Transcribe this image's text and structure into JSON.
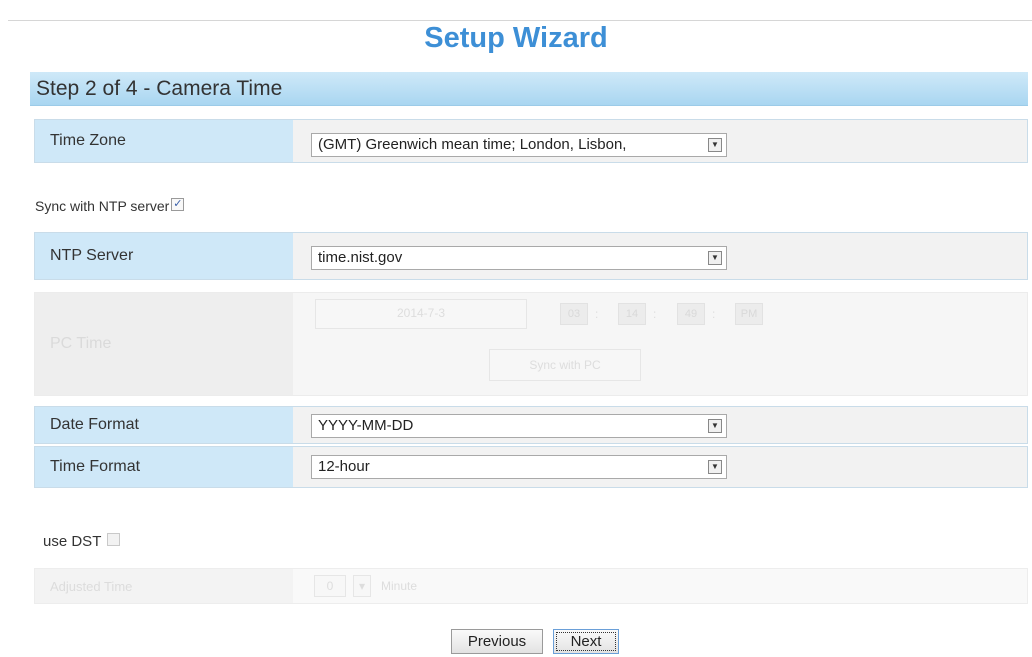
{
  "wizard": {
    "title": "Setup Wizard",
    "step": "Step 2 of 4 - Camera Time"
  },
  "time_zone": {
    "label": "Time Zone",
    "value": "(GMT) Greenwich mean time; London, Lisbon,"
  },
  "ntp_sync": {
    "label": "Sync with NTP server",
    "checked": true,
    "checkmark": "✓"
  },
  "ntp_server": {
    "label": "NTP Server",
    "value": "time.nist.gov"
  },
  "pc_time": {
    "label": "PC Time",
    "date": "2014-7-3",
    "hour": "03",
    "minute": "14",
    "second": "49",
    "ampm": "PM",
    "sync_button": "Sync with PC"
  },
  "date_format": {
    "label": "Date Format",
    "value": "YYYY-MM-DD"
  },
  "time_format": {
    "label": "Time Format",
    "value": "12-hour"
  },
  "dst": {
    "label": "use DST",
    "checked": false
  },
  "dst_adjust": {
    "label": "Adjusted Time",
    "value": "0",
    "unit": "Minute"
  },
  "buttons": {
    "previous": "Previous",
    "next": "Next"
  },
  "colors": {
    "title": "#3d8fd6",
    "header": "#a9d6f1",
    "label_bg": "#cfe8f8"
  }
}
